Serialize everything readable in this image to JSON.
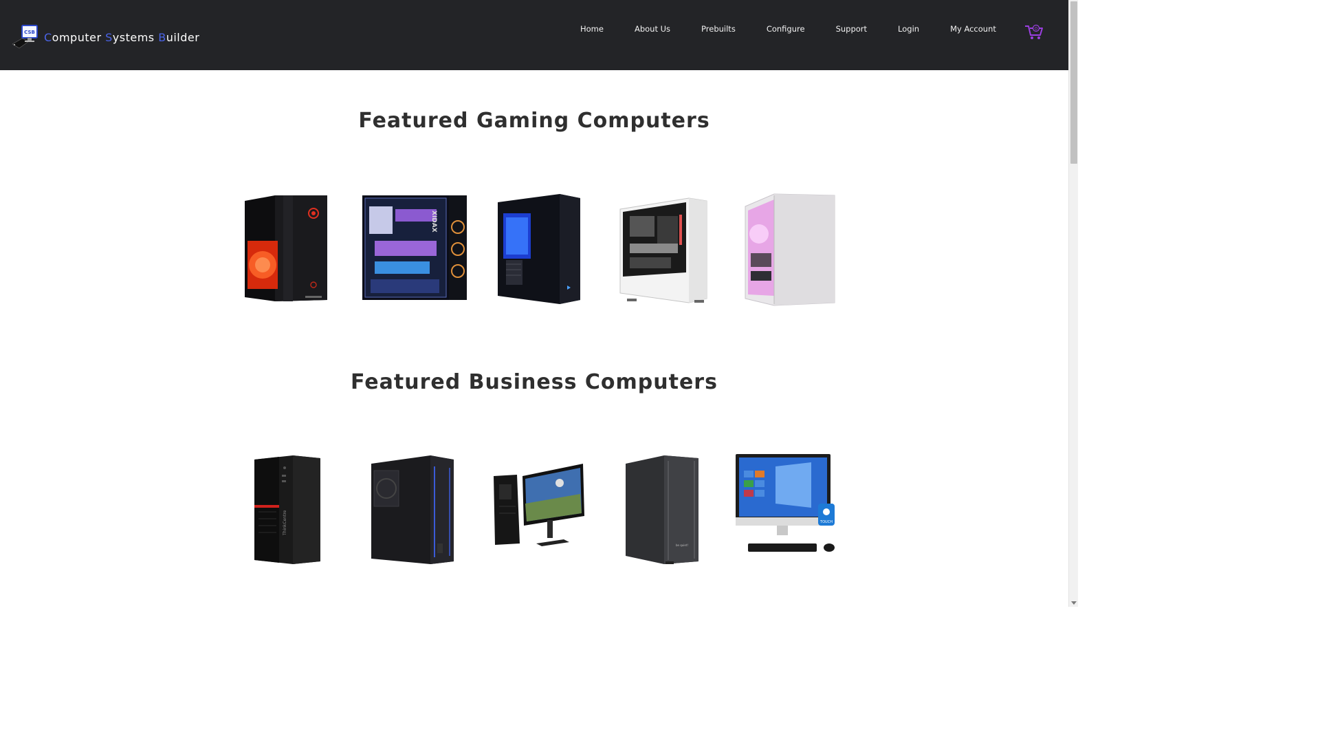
{
  "brand": {
    "logo_badge": "CSB",
    "words": [
      {
        "initial": "C",
        "rest": "omputer"
      },
      {
        "initial": "S",
        "rest": "ystems"
      },
      {
        "initial": "B",
        "rest": "uilder"
      }
    ]
  },
  "nav": {
    "items": [
      "Home",
      "About Us",
      "Prebuilts",
      "Configure",
      "Support",
      "Login",
      "My Account"
    ],
    "cart_icon": "shopping-cart-icon",
    "cart_count": "0"
  },
  "sections": {
    "gaming": {
      "title": "Featured Gaming Computers",
      "products": [
        {
          "icon": "gaming-pc-red-glow"
        },
        {
          "icon": "gaming-pc-glass-rgb"
        },
        {
          "icon": "gaming-pc-blue-glow"
        },
        {
          "icon": "gaming-pc-white-case"
        },
        {
          "icon": "gaming-pc-white-pink"
        }
      ]
    },
    "business": {
      "title": "Featured Business Computers",
      "products": [
        {
          "icon": "business-tower-thinkcentre",
          "case_text": "ThinkCentre"
        },
        {
          "icon": "business-tower-black"
        },
        {
          "icon": "workstation-with-monitor"
        },
        {
          "icon": "business-tower-gray",
          "case_text": "be quiet!"
        },
        {
          "icon": "all-in-one-touch-pc",
          "badge_text": "TOUCH"
        }
      ]
    }
  },
  "colors": {
    "navbar_bg": "#232427",
    "brand_accent": "#4a63e6",
    "cart_accent": "#9b3fe0",
    "title_text": "#2f2f2f"
  }
}
